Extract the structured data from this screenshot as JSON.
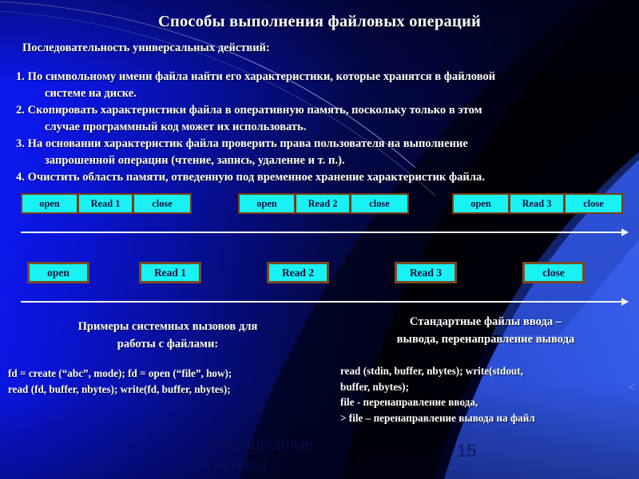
{
  "slide": {
    "title": "Способы выполнения файловых операций",
    "subtitle": "Последовательность универсальных  действий:",
    "steps": [
      {
        "num": "1.",
        "line1": "По символьному имени файла найти его характеристики, которые хранятся в файловой",
        "line2": "системе на диске."
      },
      {
        "num": "2.",
        "line1": "Скопировать характеристики файла в оперативную память, поскольку только в этом",
        "line2": "случае программный код может их использовать."
      },
      {
        "num": "3.",
        "line1": "На основании характеристик файла проверить права пользователя на выполнение",
        "line2": "запрошенной операции (чтение, запись, удаление и т. п.)."
      },
      {
        "num": "4.",
        "line1": "Очистить область памяти, отведенную под временное хранение характеристик файла.",
        "line2": ""
      }
    ],
    "row1_groups": [
      {
        "cells": [
          "open",
          "Read 1",
          "close"
        ]
      },
      {
        "cells": [
          "open",
          "Read 2",
          "close"
        ]
      },
      {
        "cells": [
          "open",
          "Read 3",
          "close"
        ]
      }
    ],
    "row2_boxes": [
      "open",
      "Read 1",
      "Read 2",
      "Read 3",
      "close"
    ],
    "left_block": {
      "heading_line1": "Примеры системных вызовов для",
      "heading_line2": "работы с файлами:",
      "body_line1": "fd = create (“abc”, mode);   fd = open (“file”, how);",
      "body_line2": "read (fd, buffer, nbytes);   write(fd, buffer, nbytes);"
    },
    "right_block": {
      "heading_line1": "Стандартные файлы ввода –",
      "heading_line2": "вывода, перенаправление вывода",
      "body_line1": "read (stdin, buffer, nbytes);   write(stdout,",
      "body_line2": "buffer, nbytes);",
      "body_line3": "file  - перенаправление ввода,",
      "body_line4": "> file – перенаправление вывода на файл"
    },
    "edge_marker": "<",
    "footer": {
      "text_line1": "Операционные",
      "text_line2": "системы",
      "page_number": "15"
    },
    "colors": {
      "box_fill": "#18f2f2",
      "box_border": "#7a3b10",
      "box_text": "#10104a",
      "text": "#ffffff",
      "bg_blue": "#0b18ec",
      "bg_dark": "#000008",
      "arrow": "#f2f2f2",
      "accent_panel": "#2f55d8"
    }
  }
}
